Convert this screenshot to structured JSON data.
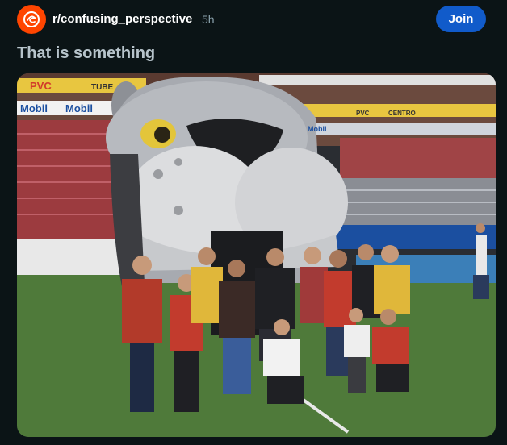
{
  "post": {
    "subreddit": "r/confusing_perspective",
    "age": "5h",
    "join_label": "Join",
    "title": "That is something"
  },
  "icons": {
    "subreddit": "subreddit-avatar-icon"
  },
  "colors": {
    "background": "#0b1416",
    "join_button": "#115bca",
    "avatar": "#ff4500",
    "title": "#b7c4cb"
  },
  "photo": {
    "banners": [
      "PVC",
      "TUBE",
      "Mobil",
      "Mobil",
      "CENTRO",
      "PVC",
      "Mobil"
    ]
  }
}
